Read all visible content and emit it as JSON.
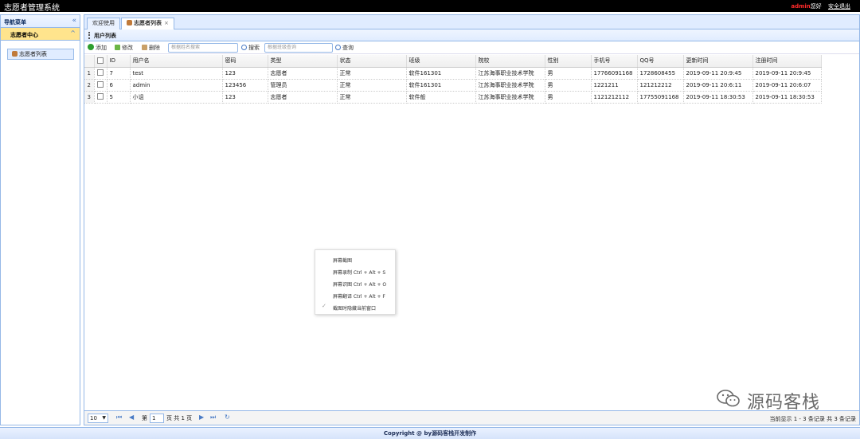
{
  "app": {
    "title": "志愿者管理系统"
  },
  "user": {
    "name": "admin",
    "greeting": "您好",
    "logout": "安全退出"
  },
  "sidebar": {
    "title": "导航菜单",
    "collapse": "«",
    "section": "志愿者中心",
    "section_toggle": "^",
    "items": [
      {
        "label": "志愿者列表"
      }
    ]
  },
  "tabs": [
    {
      "label": "欢迎使用"
    },
    {
      "label": "志愿者列表",
      "close": "×"
    }
  ],
  "panel": {
    "title": "用户列表"
  },
  "toolbar": {
    "add": "添加",
    "edit": "修改",
    "delete": "删除",
    "name_placeholder": "根据姓名搜索",
    "search": "搜索",
    "class_placeholder": "根据班级查询",
    "query": "查询"
  },
  "table": {
    "headers": [
      "ID",
      "用户名",
      "密码",
      "类型",
      "状态",
      "班级",
      "院校",
      "性别",
      "手机号",
      "QQ号",
      "更新时间",
      "注册时间"
    ],
    "rows": [
      {
        "rn": "1",
        "id": "7",
        "username": "test",
        "password": "123",
        "type": "志愿者",
        "status": "正常",
        "class": "软件161301",
        "school": "江苏海事职业技术学院",
        "gender": "男",
        "phone": "17766091168",
        "qq": "1728608455",
        "updated": "2019-09-11 20:9:45",
        "registered": "2019-09-11 20:9:45"
      },
      {
        "rn": "2",
        "id": "6",
        "username": "admin",
        "password": "123456",
        "type": "管理员",
        "status": "正常",
        "class": "软件161301",
        "school": "江苏海事职业技术学院",
        "gender": "男",
        "phone": "1221211",
        "qq": "121212212",
        "updated": "2019-09-11 20:6:11",
        "registered": "2019-09-11 20:6:07"
      },
      {
        "rn": "3",
        "id": "5",
        "username": "小诅",
        "password": "123",
        "type": "志愿者",
        "status": "正常",
        "class": "软件般",
        "school": "江苏海事职业技术学院",
        "gender": "男",
        "phone": "1121212112",
        "qq": "17755091168",
        "updated": "2019-09-11 18:30:53",
        "registered": "2019-09-11 18:30:53"
      }
    ]
  },
  "pager": {
    "page_size": "10",
    "page_prefix": "第",
    "page": "1",
    "page_suffix": "页 共 1 页",
    "info": "当前显示 1 - 3 条记录 共 3 条记录"
  },
  "footer": {
    "text": "Copyright @ by源码客栈开发制作"
  },
  "context_menu": {
    "items": [
      "屏幕截图",
      "屏幕录制 Ctrl + Alt + S",
      "屏幕识图 Ctrl + Alt + O",
      "屏幕翻译 Ctrl + Alt + F",
      "截图时隐藏当前窗口"
    ],
    "check": "✓"
  },
  "watermark": {
    "text": "源码客栈"
  }
}
